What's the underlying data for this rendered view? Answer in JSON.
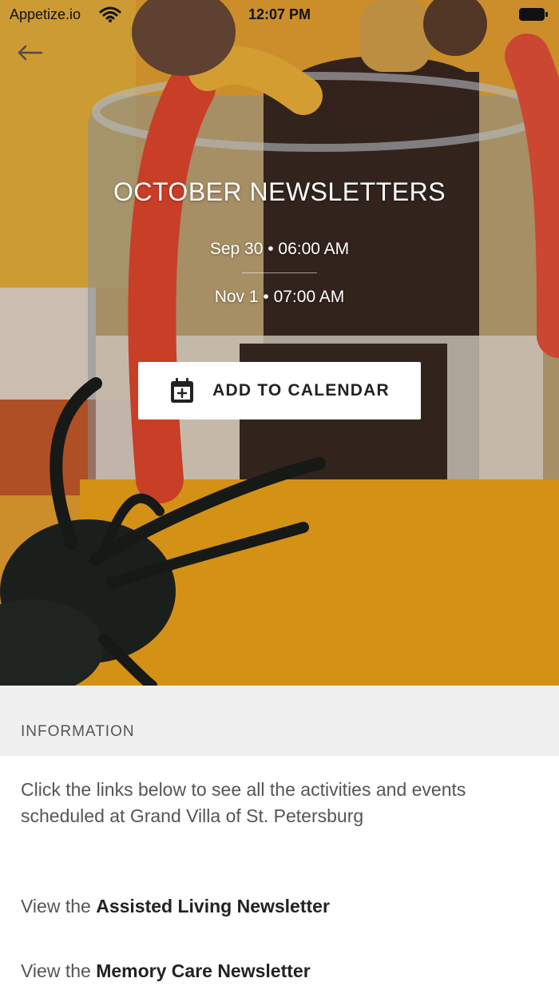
{
  "status_bar": {
    "carrier": "Appetize.io",
    "time": "12:07 PM"
  },
  "event": {
    "title": "OCTOBER NEWSLETTERS",
    "start": "Sep 30 • 06:00 AM",
    "end": "Nov 1 • 07:00 AM",
    "add_to_calendar_label": "ADD TO CALENDAR"
  },
  "information": {
    "header": "INFORMATION",
    "body": "Click the links below to see all the activities and events scheduled at Grand Villa of St. Petersburg",
    "links": [
      {
        "prefix": "View the ",
        "name": "Assisted Living Newsletter"
      },
      {
        "prefix": "View the ",
        "name": "Memory Care Newsletter"
      }
    ]
  },
  "icons": {
    "back": "arrow-left-icon",
    "wifi": "wifi-icon",
    "battery": "battery-icon",
    "calendar": "calendar-add-icon"
  },
  "colors": {
    "hero_overlay_text": "#ffffff",
    "info_header_bg": "#f0f0f0",
    "body_text": "#555555"
  }
}
